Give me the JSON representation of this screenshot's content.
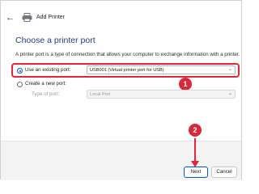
{
  "window": {
    "title": "Add Printer"
  },
  "page": {
    "heading": "Choose a printer port",
    "description": "A printer port is a type of connection that allows your computer to exchange information with a printer."
  },
  "options": {
    "existing": {
      "label": "Use an existing port:",
      "value": "USB001 (Virtual printer port for USB)"
    },
    "new": {
      "label": "Create a new port:",
      "type_label": "Type of port:",
      "type_value": "Local Port"
    }
  },
  "annotations": {
    "badge1": "1",
    "badge2": "2",
    "highlight_color": "#e0283a"
  },
  "buttons": {
    "next": "Next",
    "cancel": "Cancel"
  }
}
